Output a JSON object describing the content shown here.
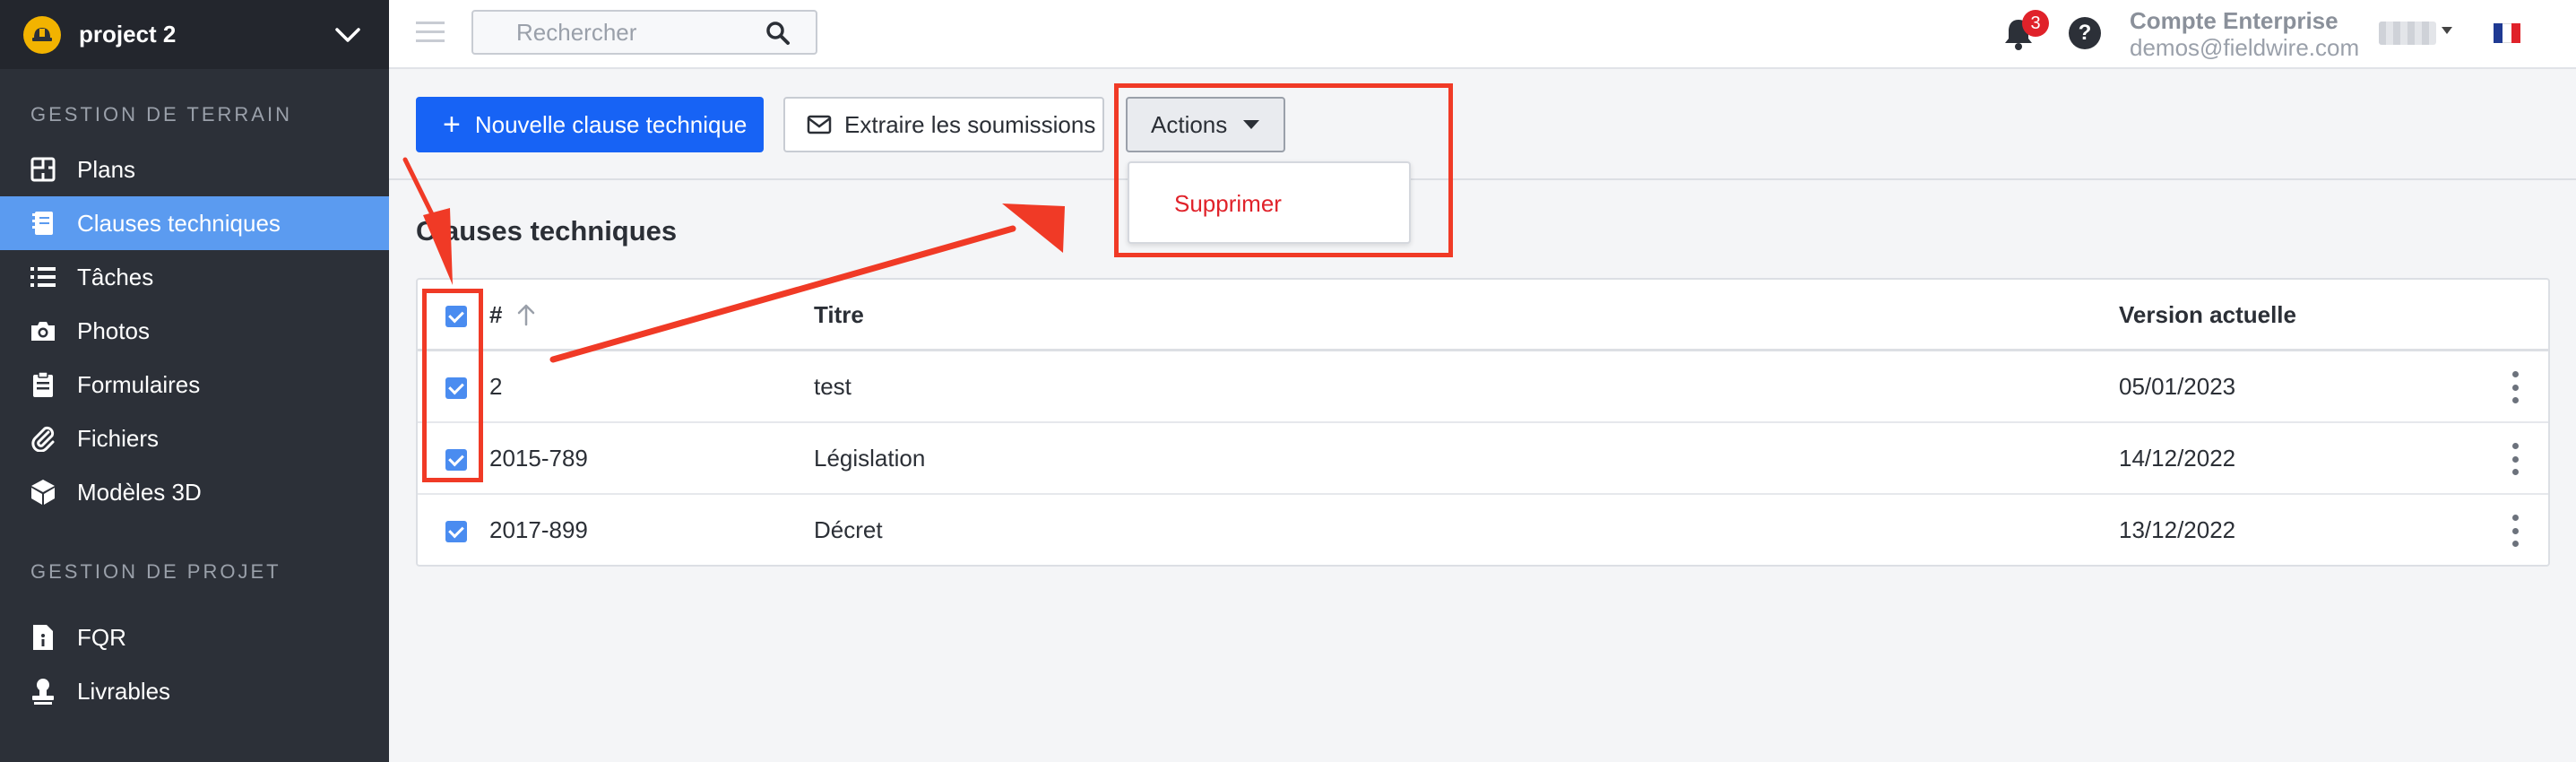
{
  "project": {
    "name": "project 2"
  },
  "sidebar": {
    "sections": [
      {
        "title": "GESTION DE TERRAIN"
      },
      {
        "title": "GESTION DE PROJET"
      }
    ],
    "items": [
      {
        "label": "Plans",
        "icon": "plans-icon"
      },
      {
        "label": "Clauses techniques",
        "icon": "specs-icon",
        "active": true
      },
      {
        "label": "Tâches",
        "icon": "tasks-list-icon"
      },
      {
        "label": "Photos",
        "icon": "camera-icon"
      },
      {
        "label": "Formulaires",
        "icon": "clipboard-icon"
      },
      {
        "label": "Fichiers",
        "icon": "paperclip-icon"
      },
      {
        "label": "Modèles 3D",
        "icon": "cube-icon"
      },
      {
        "label": "FQR",
        "icon": "document-info-icon"
      },
      {
        "label": "Livrables",
        "icon": "stamp-icon"
      }
    ]
  },
  "header": {
    "search_placeholder": "Rechercher",
    "notifications_count": "3",
    "help_label": "?",
    "account_name": "Compte Enterprise",
    "account_email": "demos@fieldwire.com"
  },
  "toolbar": {
    "new_clause_label": "Nouvelle clause technique",
    "extract_label": "Extraire les soumissions",
    "actions_label": "Actions",
    "dropdown_delete_label": "Supprimer"
  },
  "main": {
    "title": "Clauses techniques",
    "table": {
      "headers": {
        "number": "#",
        "title": "Titre",
        "version": "Version actuelle"
      },
      "rows": [
        {
          "number": "2",
          "title": "test",
          "version": "05/01/2023",
          "checked": true
        },
        {
          "number": "2015-789",
          "title": "Législation",
          "version": "14/12/2022",
          "checked": true
        },
        {
          "number": "2017-899",
          "title": "Décret",
          "version": "13/12/2022",
          "checked": true
        }
      ]
    }
  },
  "colors": {
    "sidebar_bg": "#2c3038",
    "active_item": "#5b9bf0",
    "primary_button": "#1763f5",
    "danger_text": "#e0222a",
    "annotation": "#f03a26"
  }
}
